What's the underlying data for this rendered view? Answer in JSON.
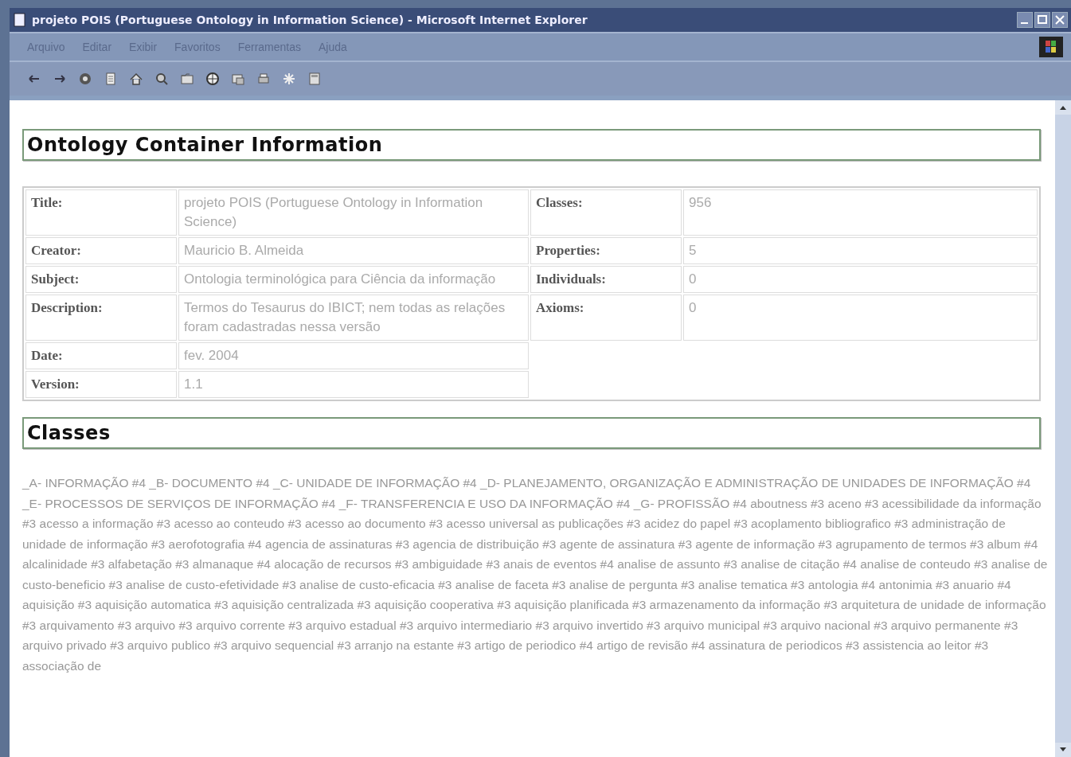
{
  "window": {
    "title": "projeto POIS (Portuguese Ontology in Information Science) - Microsoft Internet Explorer"
  },
  "menu": [
    "Arquivo",
    "Editar",
    "Exibir",
    "Favoritos",
    "Ferramentas",
    "Ajuda"
  ],
  "container": {
    "heading": "Ontology Container Information",
    "left": [
      {
        "label": "Title:",
        "value": "projeto POIS (Portuguese Ontology in Information Science)"
      },
      {
        "label": "Creator:",
        "value": "Mauricio B. Almeida"
      },
      {
        "label": "Subject:",
        "value": "Ontologia terminológica para Ciência da informação"
      },
      {
        "label": "Description:",
        "value": "Termos do Tesaurus do IBICT; nem todas as relações foram cadastradas nessa versão"
      },
      {
        "label": "Date:",
        "value": "fev. 2004"
      },
      {
        "label": "Version:",
        "value": "1.1"
      }
    ],
    "right": [
      {
        "label": "Classes:",
        "value": "956"
      },
      {
        "label": "Properties:",
        "value": "5"
      },
      {
        "label": "Individuals:",
        "value": "0"
      },
      {
        "label": "Axioms:",
        "value": "0"
      }
    ]
  },
  "classes": {
    "heading": "Classes",
    "text": "_A- INFORMAÇÃO #4 _B- DOCUMENTO #4 _C- UNIDADE DE INFORMAÇÃO #4 _D- PLANEJAMENTO, ORGANIZAÇÃO E ADMINISTRAÇÃO DE UNIDADES DE INFORMAÇÃO #4 _E- PROCESSOS DE SERVIÇOS DE INFORMAÇÃO #4 _F- TRANSFERENCIA E USO DA INFORMAÇÃO #4 _G- PROFISSÃO #4 aboutness #3 aceno #3 acessibilidade da informação #3 acesso a informação #3 acesso ao conteudo #3 acesso ao documento #3 acesso universal as publicações #3 acidez do papel #3 acoplamento bibliografico #3 administração de unidade de informação #3 aerofotografia #4 agencia de assinaturas #3 agencia de distribuição #3 agente de assinatura #3 agente de informação #3 agrupamento de termos #3 album #4 alcalinidade #3 alfabetação #3 almanaque #4 alocação de recursos #3 ambiguidade #3 anais de eventos #4 analise de assunto #3 analise de citação #4 analise de conteudo #3 analise de custo-beneficio #3 analise de custo-efetividade #3 analise de custo-eficacia #3 analise de faceta #3 analise de pergunta #3 analise tematica #3 antologia #4 antonimia #3 anuario #4 aquisição #3 aquisição automatica #3 aquisição centralizada #3 aquisição cooperativa #3 aquisição planificada #3 armazenamento da informação #3 arquitetura de unidade de informação #3 arquivamento #3 arquivo #3 arquivo corrente #3 arquivo estadual #3 arquivo intermediario #3 arquivo invertido #3 arquivo municipal #3 arquivo nacional #3 arquivo permanente #3 arquivo privado #3 arquivo publico #3 arquivo sequencial #3 arranjo na estante #3 artigo de periodico #4 artigo de revisão #4 assinatura de periodicos #3 assistencia ao leitor #3 associação de"
  }
}
